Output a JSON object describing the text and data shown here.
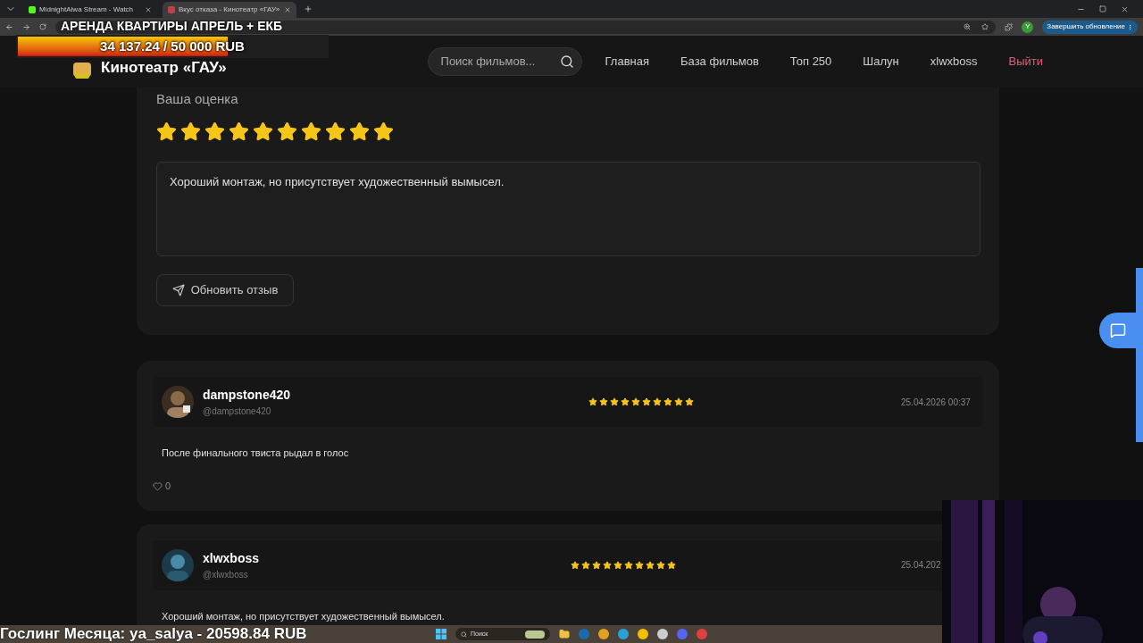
{
  "browser": {
    "tabs": [
      {
        "title": "MidnightAlwa Stream - Watch",
        "selected": false
      },
      {
        "title": "Вкус отказа - Кинотеатр «ГАУ»",
        "selected": true
      }
    ],
    "profile_initial": "Y",
    "update_button": "Завершить обновление"
  },
  "stream_overlay": {
    "goal_title": "АРЕНДА КВАРТИРЫ АПРЕЛЬ + ЕКБ",
    "goal_progress": "34 137.24 / 50 000 RUB",
    "level": 0.68,
    "ticker": "Гослинг Месяца: ya_salya - 20598.84 RUB"
  },
  "header": {
    "logo_text": "Кинотеатр «ГАУ»",
    "search_placeholder": "Поиск фильмов...",
    "nav": [
      {
        "label": "Главная",
        "kind": "link"
      },
      {
        "label": "База фильмов",
        "kind": "link"
      },
      {
        "label": "Топ 250",
        "kind": "link"
      },
      {
        "label": "Шалун",
        "kind": "link"
      },
      {
        "label": "xlwxboss",
        "kind": "link"
      },
      {
        "label": "Выйти",
        "kind": "logout"
      }
    ]
  },
  "rating_form": {
    "label": "Ваша оценка",
    "stars": 10,
    "review_text": "Хороший монтаж, но присутствует художественный вымысел.",
    "submit_button": "Обновить отзыв"
  },
  "reviews": [
    {
      "name": "dampstone420",
      "handle": "@dampstone420",
      "stars": 10,
      "date": "25.04.2026 00:37",
      "text": "После финального твиста рыдал в голос",
      "likes": "0"
    },
    {
      "name": "xlwxboss",
      "handle": "@xlwxboss",
      "stars": 10,
      "date": "25.04.202",
      "text": "Хороший монтаж, но присутствует художественный вымысел."
    }
  ],
  "taskbar": {
    "search_placeholder": "Поиск"
  }
}
